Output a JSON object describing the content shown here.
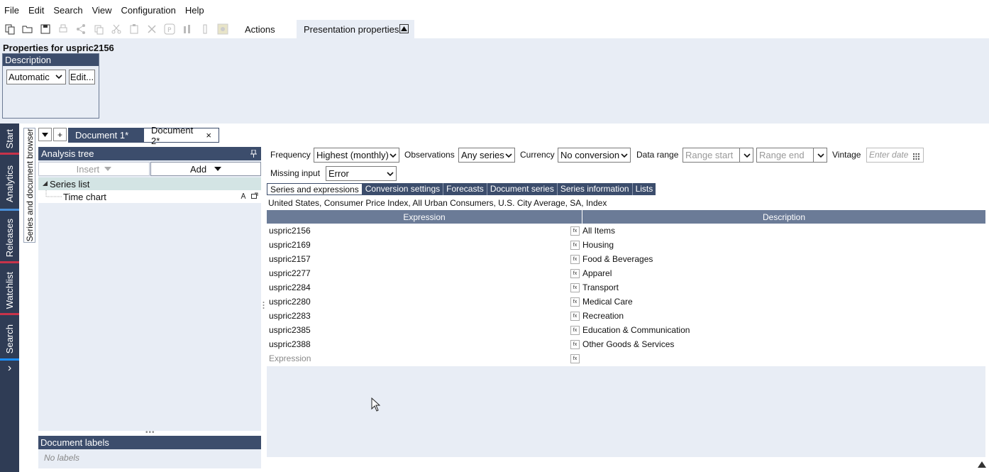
{
  "menu": [
    "File",
    "Edit",
    "Search",
    "View",
    "Configuration",
    "Help"
  ],
  "toolbar": {
    "icons": [
      "new-icon",
      "open-icon",
      "save-icon",
      "print-icon",
      "share-icon",
      "copy-icon",
      "cut-icon",
      "paste-icon",
      "delete-icon",
      "p-icon",
      "chart-icon",
      "column-icon",
      "image-icon"
    ],
    "actions_label": "Actions",
    "presentation_label": "Presentation properties"
  },
  "properties": {
    "title": "Properties for uspric2156",
    "description_header": "Description",
    "description_mode": "Automatic",
    "edit_label": "Edit..."
  },
  "left_tabs": [
    {
      "label": "Start",
      "color": "#c8334a"
    },
    {
      "label": "Analytics",
      "color": "#4a90d9"
    },
    {
      "label": "Releases",
      "color": "#c8334a"
    },
    {
      "label": "Watchlist",
      "color": "#c8334a"
    },
    {
      "label": "Search",
      "color": "#1e90ff"
    }
  ],
  "expand_glyph": "›",
  "browser_tab_label": "Series and document browser",
  "doc_tabs": {
    "doc1": "Document 1*",
    "doc2": "Document 2*",
    "plus": "+",
    "close": "×"
  },
  "analysis_tree": {
    "title": "Analysis tree",
    "insert_label": "Insert",
    "add_label": "Add",
    "series_list": "Series list",
    "time_chart": "Time chart"
  },
  "document_labels": {
    "title": "Document labels",
    "empty": "No labels"
  },
  "filters": {
    "frequency_label": "Frequency",
    "frequency_value": "Highest (monthly)",
    "observations_label": "Observations",
    "observations_value": "Any series",
    "currency_label": "Currency",
    "currency_value": "No conversion",
    "data_range_label": "Data range",
    "range_start": "Range start",
    "range_end": "Range end",
    "vintage_label": "Vintage",
    "vintage_placeholder": "Enter date",
    "missing_input_label": "Missing input",
    "missing_input_value": "Error"
  },
  "inner_tabs": [
    "Series and expressions",
    "Conversion settings",
    "Forecasts",
    "Document series",
    "Series information",
    "Lists"
  ],
  "series_title": "United States, Consumer Price Index, All Urban Consumers, U.S. City Average, SA, Index",
  "table": {
    "headers": [
      "Expression",
      "Description"
    ],
    "rows": [
      {
        "expr": "uspric2156",
        "desc": "All Items"
      },
      {
        "expr": "uspric2169",
        "desc": "Housing"
      },
      {
        "expr": "uspric2157",
        "desc": "Food & Beverages"
      },
      {
        "expr": "uspric2277",
        "desc": "Apparel"
      },
      {
        "expr": "uspric2284",
        "desc": "Transport"
      },
      {
        "expr": "uspric2280",
        "desc": "Medical Care"
      },
      {
        "expr": "uspric2283",
        "desc": "Recreation"
      },
      {
        "expr": "uspric2385",
        "desc": "Education & Communication"
      },
      {
        "expr": "uspric2388",
        "desc": "Other Goods & Services"
      }
    ],
    "placeholder_row": "Expression",
    "fx_label": "fx"
  }
}
